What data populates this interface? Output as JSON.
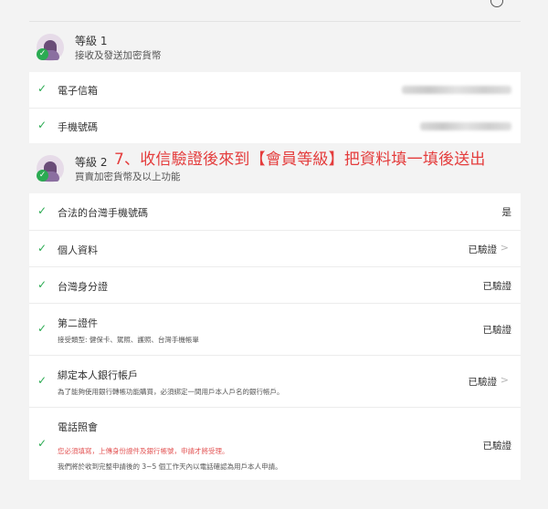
{
  "level1": {
    "title": "等級 1",
    "subtitle": "接收及發送加密貨幣",
    "rows": [
      {
        "label": "電子信箱"
      },
      {
        "label": "手機號碼"
      }
    ]
  },
  "level2": {
    "title": "等級 2",
    "subtitle": "買賣加密貨幣及以上功能",
    "rows": [
      {
        "label": "合法的台灣手機號碼",
        "status": "是"
      },
      {
        "label": "個人資料",
        "status": "已驗證"
      },
      {
        "label": "台灣身分證",
        "status": "已驗證"
      },
      {
        "label": "第二證件",
        "note": "接受類型: 健保卡、駕照、護照、台灣手機帳單",
        "status": "已驗證"
      },
      {
        "label": "綁定本人銀行帳戶",
        "note": "為了能夠使用銀行轉帳功能購買，必須綁定一間用戶本人戶名的銀行帳戶。",
        "status": "已驗證"
      },
      {
        "label": "電話照會",
        "note_red": "您必須填寫，上傳身份證件及銀行帳號，申請才將受理。",
        "note": "我們將於收到完整申請後的 3~5 個工作天內以電話確認為用戶本人申請。",
        "status": "已驗證"
      }
    ]
  },
  "annotation": "7、收信驗證後來到【會員等級】把資料填一填後送出",
  "icons": {
    "check": "check-icon",
    "chevron": "chevron-right-icon",
    "help": "help-circle-icon"
  },
  "colors": {
    "check_green": "#2bab52",
    "annotation_red": "#e43c3c",
    "note_red": "#e35555"
  }
}
